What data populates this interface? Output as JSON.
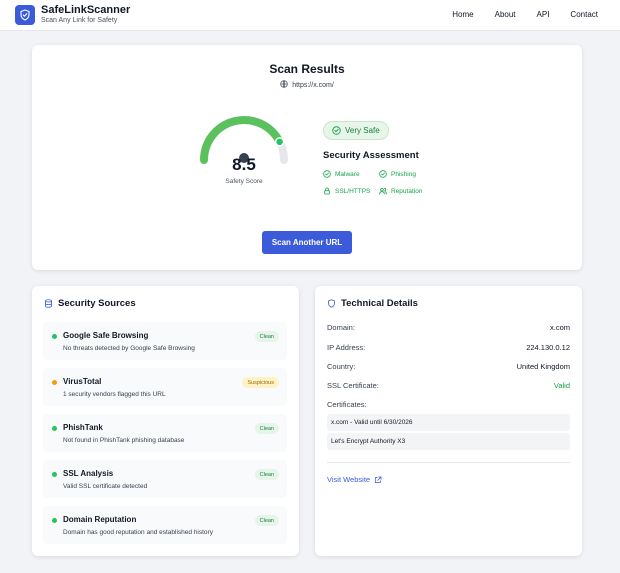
{
  "header": {
    "brand": "SafeLinkScanner",
    "tagline": "Scan Any Link for Safety",
    "nav": [
      "Home",
      "About",
      "API",
      "Contact"
    ]
  },
  "results": {
    "title": "Scan Results",
    "url": "https://x.com/",
    "score": "8.5",
    "score_fraction": 0.85,
    "score_label": "Safety Score",
    "verdict": "Very Safe",
    "assessment_title": "Security Assessment",
    "checks": [
      "Malware",
      "Phishing",
      "SSL/HTTPS",
      "Reputation"
    ],
    "scan_button": "Scan Another URL"
  },
  "sources": {
    "title": "Security Sources",
    "items": [
      {
        "name": "Google Safe Browsing",
        "desc": "No threats detected by Google Safe Browsing",
        "status": "Clean"
      },
      {
        "name": "VirusTotal",
        "desc": "1 security vendors flagged this URL",
        "status": "Suspicious"
      },
      {
        "name": "PhishTank",
        "desc": "Not found in PhishTank phishing database",
        "status": "Clean"
      },
      {
        "name": "SSL Analysis",
        "desc": "Valid SSL certificate detected",
        "status": "Clean"
      },
      {
        "name": "Domain Reputation",
        "desc": "Domain has good reputation and established history",
        "status": "Clean"
      }
    ]
  },
  "tech": {
    "title": "Technical Details",
    "domain_label": "Domain:",
    "domain": "x.com",
    "ip_label": "IP Address:",
    "ip": "224.130.0.12",
    "country_label": "Country:",
    "country": "United Kingdom",
    "ssl_label": "SSL Certificate:",
    "ssl": "Valid",
    "certs_label": "Certificates:",
    "certs": [
      "x.com - Valid until 6/30/2026",
      "Let's Encrypt Authority X3"
    ],
    "visit": "Visit Website"
  },
  "colors": {
    "accent": "#3b5bdb",
    "safe_green": "#22c55e",
    "warn_amber": "#f59e0b"
  }
}
